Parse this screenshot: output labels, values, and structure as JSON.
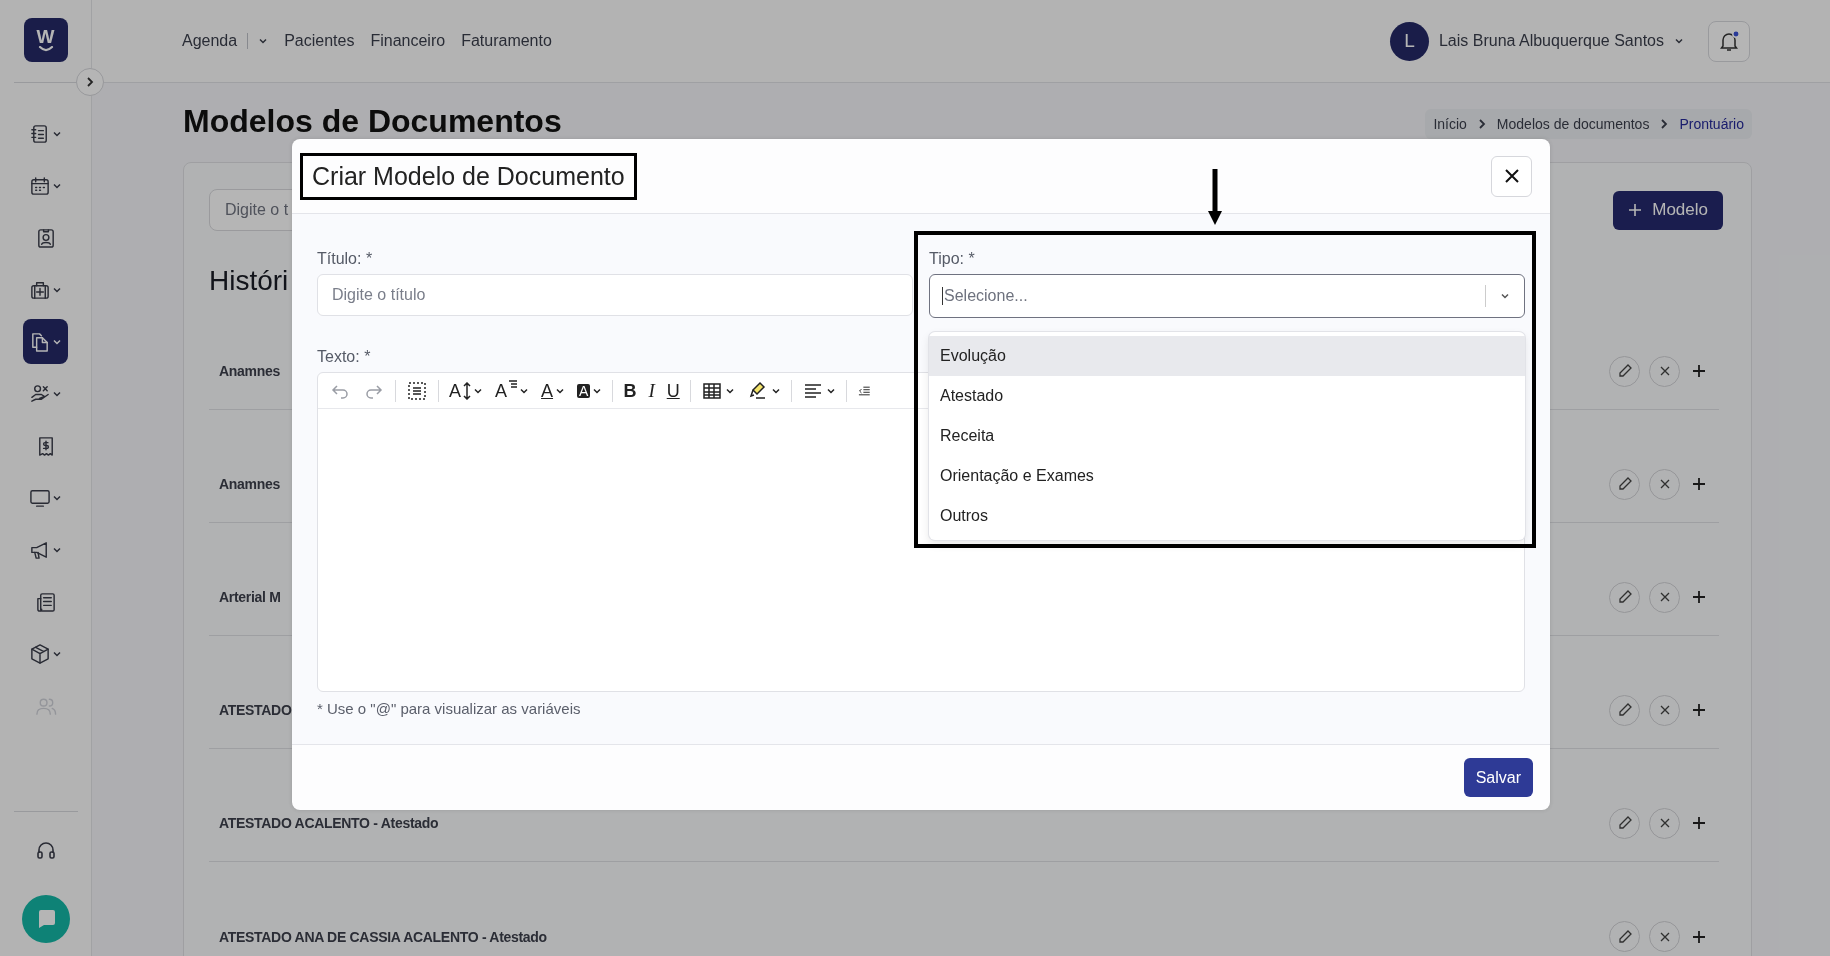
{
  "topbar": {
    "logo": "W",
    "nav": [
      {
        "label": "Agenda",
        "caret": true
      },
      {
        "label": "Pacientes",
        "caret": false
      },
      {
        "label": "Financeiro",
        "caret": false
      },
      {
        "label": "Faturamento",
        "caret": false
      }
    ],
    "user": {
      "initial": "L",
      "name": "Lais Bruna Albuquerque Santos"
    },
    "notifications": {
      "unread": true
    }
  },
  "sidebar": {
    "items": [
      {
        "kind": "notebook",
        "caret": true,
        "selected": false,
        "disabled": false
      },
      {
        "kind": "calendar",
        "caret": true,
        "selected": false,
        "disabled": false
      },
      {
        "kind": "badge",
        "caret": false,
        "selected": false,
        "disabled": false
      },
      {
        "kind": "medkit",
        "caret": true,
        "selected": false,
        "disabled": false
      },
      {
        "kind": "copy",
        "caret": true,
        "selected": true,
        "disabled": false
      },
      {
        "kind": "hand",
        "caret": true,
        "selected": false,
        "disabled": false
      },
      {
        "kind": "receipt",
        "caret": false,
        "selected": false,
        "disabled": false
      },
      {
        "kind": "monitor",
        "caret": true,
        "selected": false,
        "disabled": false
      },
      {
        "kind": "megaphone",
        "caret": true,
        "selected": false,
        "disabled": false
      },
      {
        "kind": "newspaper",
        "caret": false,
        "selected": false,
        "disabled": false
      },
      {
        "kind": "box",
        "caret": true,
        "selected": false,
        "disabled": false
      },
      {
        "kind": "users",
        "caret": false,
        "selected": false,
        "disabled": true
      }
    ]
  },
  "page": {
    "title": "Modelos de Documentos",
    "breadcrumb": [
      {
        "label": "Início",
        "current": false
      },
      {
        "label": "Modelos de documentos",
        "current": false
      },
      {
        "label": "Prontuário",
        "current": true
      }
    ],
    "search": {
      "placeholder": "Digite o t"
    },
    "new_button": "Modelo",
    "section_title": "Históri",
    "rows": [
      {
        "title": "Anamnes"
      },
      {
        "title": "Anamnes"
      },
      {
        "title": "Arterial M"
      },
      {
        "title": "ATESTADO"
      },
      {
        "title": "ATESTADO ACALENTO - Atestado"
      },
      {
        "title": "ATESTADO ANA DE CASSIA ACALENTO - Atestado"
      }
    ]
  },
  "modal": {
    "title": "Criar Modelo de Documento",
    "title_field": {
      "label": "Título: *",
      "placeholder": "Digite o título"
    },
    "type_field": {
      "label": "Tipo: *",
      "placeholder": "Selecione...",
      "expanded": true,
      "options": [
        {
          "label": "Evolução",
          "highlighted": true
        },
        {
          "label": "Atestado",
          "highlighted": false
        },
        {
          "label": "Receita",
          "highlighted": false
        },
        {
          "label": "Orientação e Exames",
          "highlighted": false
        },
        {
          "label": "Outros",
          "highlighted": false
        }
      ]
    },
    "text_field": {
      "label": "Texto: *",
      "hint": "* Use o \"@\" para visualizar as variáveis",
      "toolbar": [
        {
          "kind": "undo",
          "disabled": true
        },
        {
          "kind": "redo",
          "disabled": true
        },
        {
          "kind": "sep"
        },
        {
          "kind": "select-all"
        },
        {
          "kind": "sep"
        },
        {
          "kind": "font-size",
          "glyph": "A",
          "caret": true
        },
        {
          "kind": "font-family",
          "glyph": "A",
          "caret": true
        },
        {
          "kind": "font-color",
          "glyph": "A",
          "caret": true
        },
        {
          "kind": "bg-color",
          "glyph": "A",
          "caret": true
        },
        {
          "kind": "sep"
        },
        {
          "kind": "bold",
          "glyph": "B"
        },
        {
          "kind": "italic",
          "glyph": "I"
        },
        {
          "kind": "underline",
          "glyph": "U"
        },
        {
          "kind": "sep"
        },
        {
          "kind": "table",
          "caret": true
        },
        {
          "kind": "highlight",
          "caret": true
        },
        {
          "kind": "sep"
        },
        {
          "kind": "align",
          "caret": true
        },
        {
          "kind": "sep"
        },
        {
          "kind": "outdent"
        }
      ]
    },
    "save_button": "Salvar",
    "annotations": {
      "title_box": true,
      "type_box": true,
      "arrow": true
    }
  }
}
